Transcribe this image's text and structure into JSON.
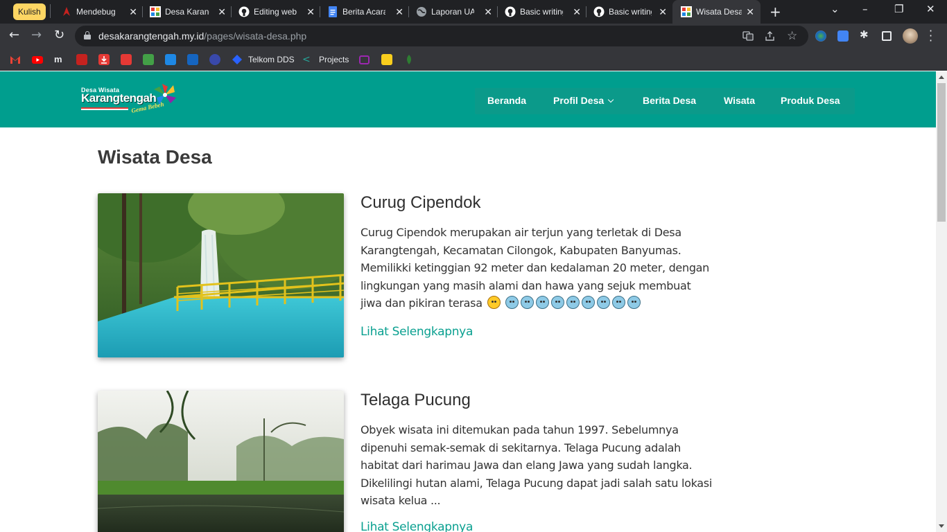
{
  "browser": {
    "tab_group": "Kulish",
    "tabs": [
      {
        "title": "Mendebug",
        "favicon_color": "#c5221f"
      },
      {
        "title": "Desa Karang",
        "favicon_color": "#ffffff"
      },
      {
        "title": "Editing web",
        "favicon_color": "#ffffff"
      },
      {
        "title": "Berita Acara",
        "favicon_color": "#4285f4"
      },
      {
        "title": "Laporan UA",
        "favicon_color": "#9aa0a6"
      },
      {
        "title": "Basic writing",
        "favicon_color": "#ffffff"
      },
      {
        "title": "Basic writing",
        "favicon_color": "#ffffff"
      },
      {
        "title": "Wisata Desa",
        "favicon_color": "#ffffff",
        "active": true
      }
    ],
    "url_host": "desakarangtengah.my.id",
    "url_path": "/pages/wisata-desa.php",
    "bookmarks": [
      {
        "label": "",
        "color": "#ea4335"
      },
      {
        "label": "",
        "color": "#ff0000"
      },
      {
        "label": "",
        "color": "#e8eaed"
      },
      {
        "label": "",
        "color": "#c5221f"
      },
      {
        "label": "",
        "color": "#e53935"
      },
      {
        "label": "",
        "color": "#e53935"
      },
      {
        "label": "",
        "color": "#43a047"
      },
      {
        "label": "",
        "color": "#1e88e5"
      },
      {
        "label": "",
        "color": "#1565c0"
      },
      {
        "label": "",
        "color": "#3949ab"
      },
      {
        "label": "Telkom DDS",
        "color": "#2962ff"
      },
      {
        "label": "Projects",
        "color": "#26a69a"
      },
      {
        "label": "",
        "color": "#7b1fa2"
      },
      {
        "label": "",
        "color": "#f9ce1d"
      },
      {
        "label": "",
        "color": "#2e7d32"
      }
    ]
  },
  "site": {
    "logo": {
      "line1": "Desa Wisata",
      "line2": "Karangtengah",
      "tagline": "Gema Bebeh"
    },
    "nav": [
      "Beranda",
      "Profil Desa",
      "Berita Desa",
      "Wisata",
      "Produk Desa"
    ],
    "colors": {
      "header": "#009e8e",
      "link": "#0aa090"
    }
  },
  "page": {
    "title": "Wisata Desa",
    "cards": [
      {
        "title": "Curug Cipendok",
        "description": "Curug Cipendok merupakan air terjun yang terletak di Desa Karangtengah, Kecamatan Cilongok, Kabupaten Banyumas. Memilikki ketinggian 92 meter dan kedalaman 20 meter, dengan lingkungan yang masih alami dan hawa yang sejuk membuat jiwa dan pikiran terasa",
        "emojis": [
          "angry",
          "cold",
          "cold",
          "cold",
          "cold",
          "cold",
          "cold",
          "cold",
          "cold",
          "cold"
        ],
        "link": "Lihat Selengkapnya"
      },
      {
        "title": "Telaga Pucung",
        "description": "Obyek wisata ini ditemukan pada tahun 1997. Sebelumnya dipenuhi semak-semak di sekitarnya. Telaga Pucung adalah habitat dari harimau Jawa dan elang Jawa yang sudah langka. Dikelilingi hutan alami, Telaga Pucung dapat jadi salah satu lokasi wisata kelua ...",
        "link": "Lihat Selengkapnya"
      }
    ]
  }
}
